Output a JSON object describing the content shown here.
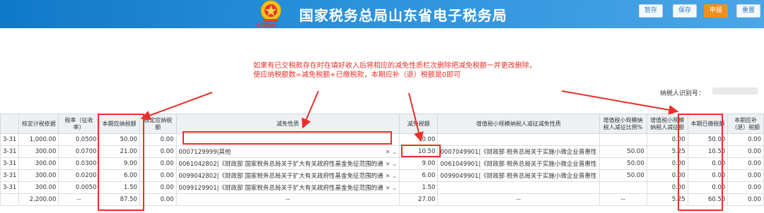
{
  "header": {
    "logo_caption": "中国税务",
    "title": "国家税务总局山东省电子税务局",
    "buttons": [
      "暂存",
      "保存",
      "申报",
      "重置"
    ]
  },
  "annotation": {
    "line1": "如果有已交税款存在时在填好收入后将相应的减免性质栏次删除把减免税额一并更改删除，",
    "line2": "使应纳税额数=减免税额+已缴税款，本期应补（退）税额是0即可"
  },
  "taxpayer": {
    "id_label": "纳税人识别号："
  },
  "table": {
    "headers": [
      "核定计税依据",
      "税率（征收率）",
      "本期应纳税额",
      "核定应纳税额",
      "减免性质",
      "减免税额",
      "增值税小规模纳税人减征减免性质",
      "增值税小规模纳税人减征比例%",
      "增值税小规模纳税人减征额",
      "本期已缴税额",
      "本期应补（退）税额"
    ],
    "rows": [
      {
        "date": "3-31",
        "basis": "1,000.00",
        "rate": "0.0500",
        "payable": "50.00",
        "assessed": "0.00",
        "relief": "",
        "relief_amt": "0.00",
        "vat_nature": "",
        "vat_ratio": "",
        "vat_amt": "0.00",
        "paid": "50.00",
        "due": "0.00"
      },
      {
        "date": "3-31",
        "basis": "300.00",
        "rate": "0.0700",
        "payable": "21.00",
        "assessed": "0.00",
        "relief": "0007129999|其他",
        "relief_amt": "10.50",
        "vat_nature": "0007049901|《财政部 税务总局关于实施小微企业普惠性",
        "vat_ratio": "50.00",
        "vat_amt": "5.25",
        "paid": "10.50",
        "due": "0.00"
      },
      {
        "date": "3-31",
        "basis": "300.00",
        "rate": "0.0300",
        "payable": "9.00",
        "assessed": "0.00",
        "relief": "0061042802|《财政部 国家税务总局关于扩大有关政府性基金免征范围的通",
        "relief_amt": "9.00",
        "vat_nature": "0061049901|《财政部 税务总局关于实施小微企业普惠性",
        "vat_ratio": "50.00",
        "vat_amt": "0.00",
        "paid": "0.00",
        "due": "0.00"
      },
      {
        "date": "3-31",
        "basis": "300.00",
        "rate": "0.0200",
        "payable": "6.00",
        "assessed": "0.00",
        "relief": "0099042802|《财政部 国家税务总局关于扩大有关政府性基金免征范围的通",
        "relief_amt": "6.00",
        "vat_nature": "0099049901|《财政部 税务总局关于实施小微企业普惠性",
        "vat_ratio": "50.00",
        "vat_amt": "0.00",
        "paid": "0.00",
        "due": "0.00"
      },
      {
        "date": "3-31",
        "basis": "300.00",
        "rate": "0.0050",
        "payable": "1.50",
        "assessed": "0.00",
        "relief": "0099129901|《财政部 国家税务总局关于扩大有关政府性基金免征范围的通",
        "relief_amt": "1.50",
        "vat_nature": "",
        "vat_ratio": "",
        "vat_amt": "0.00",
        "paid": "0.00",
        "due": "0.00"
      }
    ],
    "total": {
      "date": "",
      "basis": "2,200.00",
      "rate": "--",
      "payable": "87.50",
      "assessed": "0.00",
      "relief": "--",
      "relief_amt": "27.00",
      "vat_nature": "--",
      "vat_ratio": "--",
      "vat_amt": "5.25",
      "paid": "60.50",
      "due": "0.00"
    }
  },
  "colors": {
    "header_blue": "#1a82d0",
    "annotation_red": "#e8312a",
    "apply_orange": "#ef8f1e"
  }
}
